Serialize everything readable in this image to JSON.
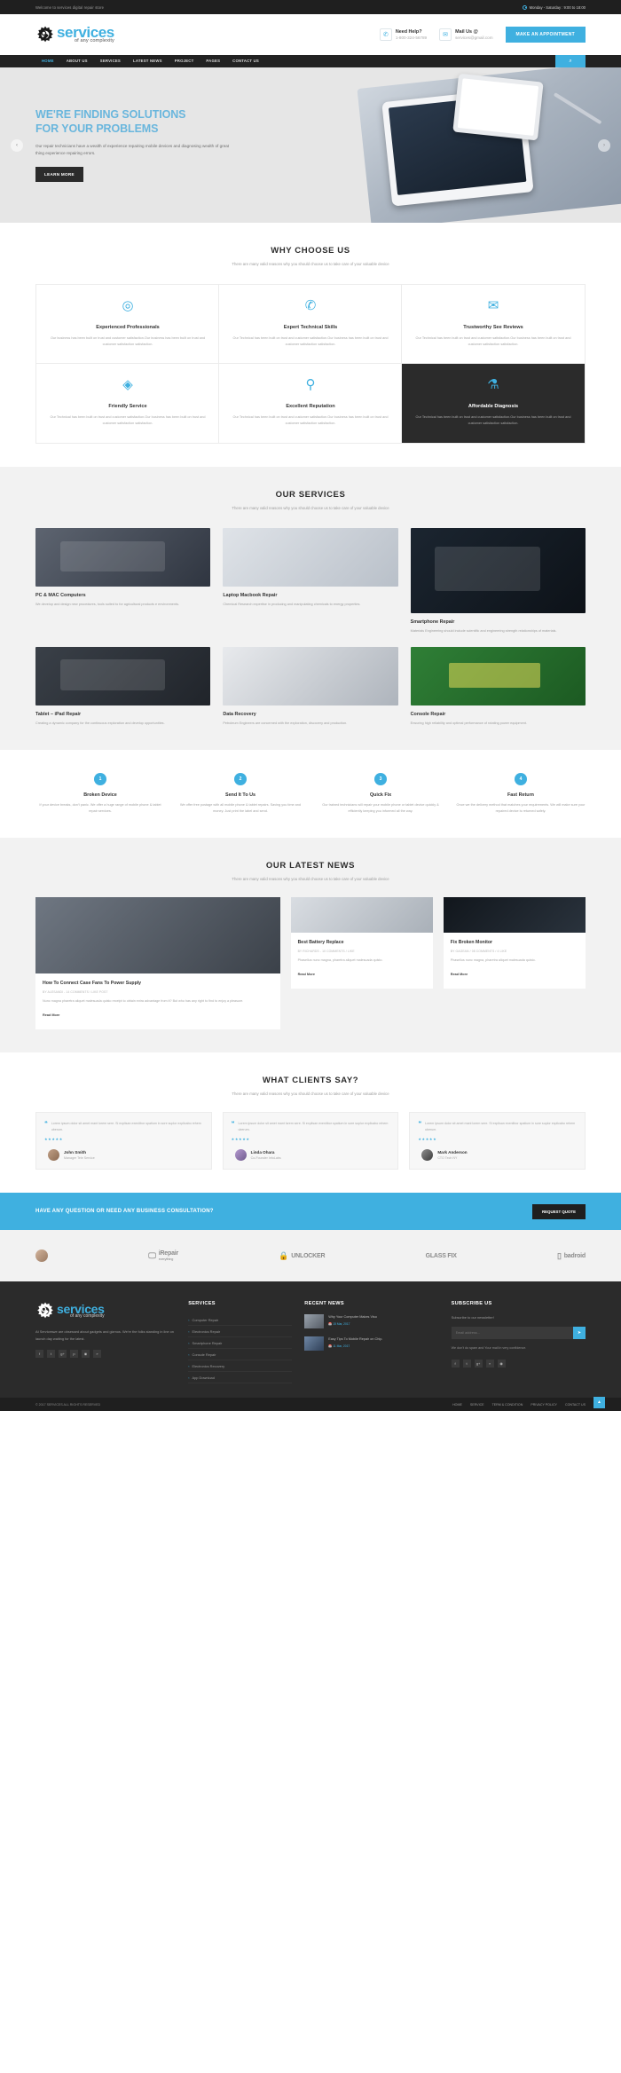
{
  "topbar": {
    "welcome": "Welcome to services digital repair store",
    "hours": "Monday - Saturday : 9:00 to 18:00",
    "clock_icon": "clock-icon"
  },
  "header": {
    "logo_main": "services",
    "logo_sub": "of any complexity",
    "phone_label": "Need Help?",
    "phone_value": "1-800-324-56789",
    "mail_label": "Mail Us @",
    "mail_value": "services@gmail.com",
    "phone_icon": "phone-icon",
    "mail_icon": "envelope-icon",
    "appointment_button": "MAKE AN APPOINTMENT"
  },
  "nav": {
    "items": [
      {
        "label": "HOME",
        "active": true
      },
      {
        "label": "ABOUT US",
        "active": false
      },
      {
        "label": "SERVICES",
        "active": false
      },
      {
        "label": "LATEST NEWS",
        "active": false
      },
      {
        "label": "PROJECT",
        "active": false
      },
      {
        "label": "PAGES",
        "active": false
      },
      {
        "label": "CONTACT US",
        "active": false
      }
    ],
    "search_icon": "search-icon"
  },
  "hero": {
    "title_line1": "WE'RE FINDING SOLUTIONS",
    "title_line2": "FOR YOUR PROBLEMS",
    "paragraph": "Our repair technicians have a wealth of experience repairing mobile devices and diagnosing wealth of great thing experience repairing errors.",
    "button": "LEARN MORE",
    "prev_icon": "chevron-left-icon",
    "next_icon": "chevron-right-icon",
    "accent_color": "#3fb0e0"
  },
  "why": {
    "title": "WHY CHOOSE US",
    "subtitle": "There are many valid reasons why you should choose us to take care of your valuable device",
    "cells": [
      {
        "icon": "target-professional-icon",
        "glyph": "◎",
        "title": "Experienced Professionals",
        "text": "Our business has been built on trust and customer satisfaction.Our business has been built on trust and customer satisfaction satisfaction.",
        "dark": false
      },
      {
        "icon": "phone-ring-icon",
        "glyph": "✆",
        "title": "Expert Technical Skills",
        "text": "Our Technical has been built on trust and customer satisfaction.Our business has been built on trust and customer satisfaction satisfaction.",
        "dark": false
      },
      {
        "icon": "envelope-icon",
        "glyph": "✉",
        "title": "Trustworthy See Reviews",
        "text": "Our Technical has been built on trust and customer satisfaction.Our business has been built on trust and customer satisfaction satisfaction.",
        "dark": false
      },
      {
        "icon": "diamond-icon",
        "glyph": "◈",
        "title": "Friendly Service",
        "text": "Our Technical has been built on trust and customer satisfaction.Our business has been built on trust and customer satisfaction satisfaction.",
        "dark": false
      },
      {
        "icon": "map-pin-icon",
        "glyph": "⚲",
        "title": "Excellent Reputation",
        "text": "Our Technical has been built on trust and customer satisfaction.Our business has been built on trust and customer satisfaction satisfaction.",
        "dark": false
      },
      {
        "icon": "microscope-icon",
        "glyph": "⚗",
        "title": "Affordable Diagnosis",
        "text": "Our Technical has been built on trust and customer satisfaction.Our business has been built on trust and customer satisfaction satisfaction.",
        "dark": true
      }
    ]
  },
  "services": {
    "title": "OUR SERVICES",
    "subtitle": "There are many valid reasons why you should choose us to take care of your valuable device",
    "cards": [
      {
        "title": "PC & MAC Computers",
        "text": "We develop and design new procedures, tools suited to for agricultural products e environments.",
        "thumb": "th-a",
        "tall": false,
        "offset": false
      },
      {
        "title": "Laptop Macbook Repair",
        "text": "Chemical Research expertise in producing and manipulating chemicals to energy properties.",
        "thumb": "th-b",
        "tall": false,
        "offset": false
      },
      {
        "title": "Smartphone Repair",
        "text": "Materials Engineering should include scientific and engineering strength relationships of materials.",
        "thumb": "th-c",
        "tall": true,
        "offset": false
      },
      {
        "title": "Tablet – iPad Repair",
        "text": "Creating a dynamic company for the continuous exploration and develop opportunities.",
        "thumb": "th-d",
        "tall": false,
        "offset": false
      },
      {
        "title": "Data Recovery",
        "text": "Petroleum Engineers are concerned with the exploration, discovery and production.",
        "thumb": "th-e",
        "tall": false,
        "offset": false
      },
      {
        "title": "Console Repair",
        "text": "Ensuring high reliability and optimal performance of rotating power equipment.",
        "thumb": "th-f",
        "tall": false,
        "offset": false
      }
    ]
  },
  "steps": [
    {
      "num": "1",
      "title": "Broken Device",
      "text": "If your device breaks, don't panic. We offer a huge range of mobile phone & tablet repair services."
    },
    {
      "num": "2",
      "title": "Send It To Us",
      "text": "We offer free postage with all mobile phone & tablet repairs. Saving you time and money. Just print the label and send."
    },
    {
      "num": "3",
      "title": "Quick Fix",
      "text": "Our trained technicians will repair your mobile phone or tablet device quickly & efficiently keeping you informed all the way."
    },
    {
      "num": "4",
      "title": "Fast Return",
      "text": "Once we the delivery method that matches your requirements. We will make sure your repaired device is returned safely."
    }
  ],
  "news": {
    "title": "OUR LATEST NEWS",
    "subtitle": "There are many valid reasons why you should choose us to take care of your valuable device",
    "big": {
      "title": "How To Connect Case Fans To Power Supply",
      "meta": "BY ALESANDI - 14 COMMENTS / LIKE POST",
      "text": "Nunc magna pharetra aliquet malesuada quisto receipt to obtain extra advantage from it? But who has any right to find to enjoy a pleasure.",
      "read_more": "Read More",
      "thumb": "b1"
    },
    "items": [
      {
        "title": "Best Battery Replace",
        "meta": "BY RICHARDS - 10 COMMENTS / LIKE",
        "text": "Phasellus nunc magna, pharetra aliquet malesuada quisto.",
        "read_more": "Read More",
        "thumb": "b2"
      },
      {
        "title": "Fix Broken Monitor",
        "meta": "BY GAGEAN / 08 COMMENTS / 4 LIKE",
        "text": "Phasellus nunc magna, pharetra aliquet malesuada quisto.",
        "read_more": "Read More",
        "thumb": "b3"
      }
    ]
  },
  "testimonials": {
    "title": "WHAT CLIENTS SAY?",
    "subtitle": "There are many valid reasons why you should choose us to take care of your valuable device",
    "items": [
      {
        "quote_icon": "quote-icon",
        "text": "Lorem ipsum dolor sit amet mant lorem sere. Si explisan exenitbor spatium in sore suplor explicabo rehem uberum.",
        "stars": "★★★★★",
        "name": "John Smith",
        "role": "Manager Tele Service",
        "avatar": "avatar-a"
      },
      {
        "quote_icon": "quote-icon",
        "text": "Lorem ipsum dolor sit amet mant lorem sere. Si explisan exenitbor spatium in sore suplor explicabo rehem uberum.",
        "stars": "★★★★★",
        "name": "Linda Ohara",
        "role": "Co-Founder InfoLabs",
        "avatar": "avatar-b"
      },
      {
        "quote_icon": "quote-icon",
        "text": "Lorem ipsum dolor sit amet mant lorem sere. Si explisan exenitbor spatium in sore suplor explicabo rehem uberum.",
        "stars": "★★★★★",
        "name": "Mark Anderson",
        "role": "CTO Tech NY",
        "avatar": "avatar-c"
      }
    ]
  },
  "cta": {
    "text": "HAVE ANY QUESTION OR NEED ANY BUSINESS CONSULTATION?",
    "button": "REQUEST QUOTE",
    "background": "#3fb0e0"
  },
  "brands": [
    {
      "name": "client-avatar",
      "label": ""
    },
    {
      "name": "irepair-everything",
      "label": "iRepair",
      "sub": "everything",
      "icon": "monitor-icon"
    },
    {
      "name": "unlocker",
      "label": "UNLOCKER",
      "icon": "lock-icon"
    },
    {
      "name": "glassfix",
      "label": "GLASS FIX",
      "icon": ""
    },
    {
      "name": "badroid",
      "label": "badroid",
      "icon": "phone-icon"
    }
  ],
  "footer": {
    "logo_main": "services",
    "logo_sub": "of any complexity",
    "about": "At Serviceswe are obsessed about gadgets and gizmos. We're the folks standing in line on launch day waiting for the latest.",
    "social": [
      {
        "name": "facebook-icon",
        "glyph": "f"
      },
      {
        "name": "twitter-icon",
        "glyph": "t"
      },
      {
        "name": "google-plus-icon",
        "glyph": "g+"
      },
      {
        "name": "pinterest-icon",
        "glyph": "p"
      },
      {
        "name": "instagram-icon",
        "glyph": "◉"
      },
      {
        "name": "rss-icon",
        "glyph": "»"
      }
    ],
    "services_title": "SERVICES",
    "services_items": [
      "Computer Repair",
      "Electronics Repair",
      "Smartphone Repair",
      "Console Repair",
      "Electronics Recovery",
      "App Download"
    ],
    "recent_title": "RECENT NEWS",
    "recent_items": [
      {
        "title": "Why Your Computer Makes Viso",
        "date": "15 Mar, 2017",
        "thumb": "a"
      },
      {
        "title": "Easy Tips To Mobile Repair on Chip.",
        "date": "11 Mar, 2017",
        "thumb": "b"
      }
    ],
    "subscribe_title": "SUBSCRIBE US",
    "subscribe_text": "Subscribe to our newsletter!",
    "subscribe_placeholder": "Email address...",
    "subscribe_button_icon": "send-icon",
    "subscribe_note": "We don't do spam and Your mail in very confidence.",
    "subscribe_social": [
      {
        "name": "facebook-icon",
        "glyph": "f"
      },
      {
        "name": "twitter-icon",
        "glyph": "t"
      },
      {
        "name": "google-plus-icon",
        "glyph": "g+"
      },
      {
        "name": "rss-icon",
        "glyph": "»"
      },
      {
        "name": "instagram-icon",
        "glyph": "◉"
      }
    ]
  },
  "copyright": {
    "text": "© 2017 SERVICES ALL RIGHTS RESERVED",
    "links": [
      "HOME",
      "SERVICE",
      "TERM & CONDITION",
      "PRIVACY POLICY",
      "CONTACT US"
    ],
    "scroll_top_icon": "chevron-up-icon"
  }
}
